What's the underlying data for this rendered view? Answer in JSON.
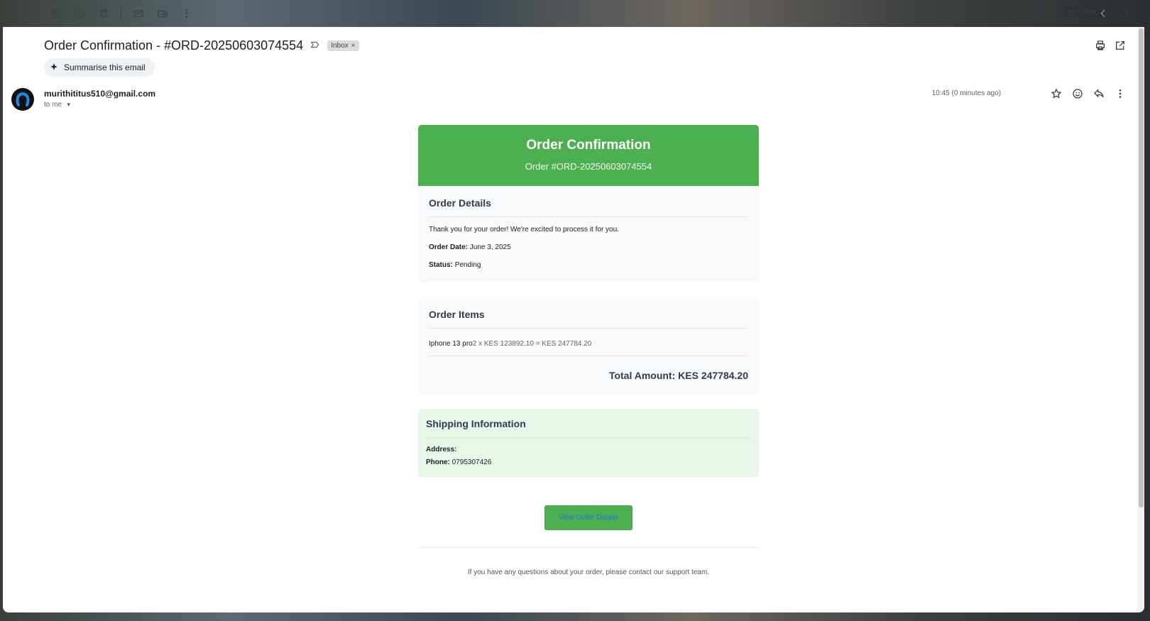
{
  "toolbar": {
    "pager_text": "1 of 7,290"
  },
  "email": {
    "subject": "Order Confirmation - #ORD-20250603074554",
    "label_chip": "Inbox",
    "summarise_label": "Summarise this email",
    "sender": "murithititus510@gmail.com",
    "to_text": "to me",
    "time": "10:45 (0 minutes ago)"
  },
  "body": {
    "hero_title": "Order Confirmation",
    "hero_subtitle": "Order #ORD-20250603074554",
    "details": {
      "heading": "Order Details",
      "thanks": "Thank you for your order! We're excited to process it for you.",
      "date_label": "Order Date:",
      "date_value": "June 3, 2025",
      "status_label": "Status:",
      "status_value": "Pending"
    },
    "items": {
      "heading": "Order Items",
      "rows": [
        {
          "name": "Iphone 13 pro",
          "calc": "2 x KES 123892.10 = KES 247784.20"
        }
      ],
      "total": "Total Amount: KES 247784.20"
    },
    "shipping": {
      "heading": "Shipping Information",
      "address_label": "Address:",
      "address_value": "",
      "phone_label": "Phone:",
      "phone_value": "0795307426"
    },
    "cta_label": "View Order Details",
    "footer": "If you have any questions about your order, please contact our support team."
  },
  "colors": {
    "brand_green": "#4caf50",
    "shipping_bg": "#e8f5e9",
    "link_blue": "#1a73e8"
  }
}
